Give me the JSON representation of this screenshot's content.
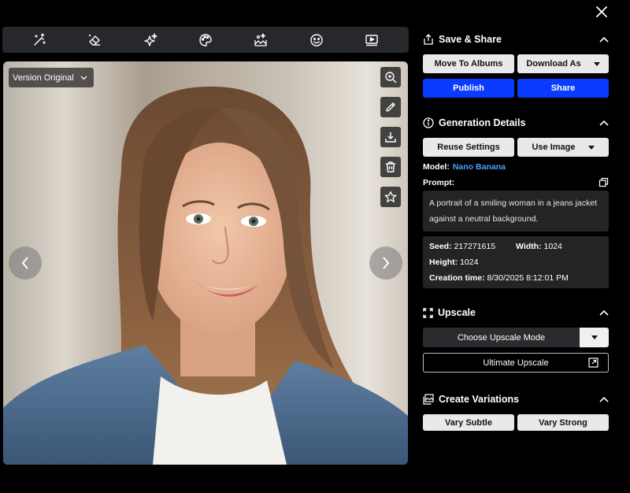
{
  "toolbar": {
    "tools": [
      "magic-wand-icon",
      "eraser-icon",
      "sparkles-icon",
      "palette-icon",
      "image-edit-icon",
      "smiley-icon",
      "video-icon"
    ]
  },
  "viewer": {
    "version_label": "Version Original",
    "side_actions": [
      "zoom-in-icon",
      "pencil-icon",
      "download-icon",
      "trash-icon",
      "star-icon"
    ]
  },
  "save_share": {
    "title": "Save & Share",
    "move_to_albums": "Move To Albums",
    "download_as": "Download As",
    "publish": "Publish",
    "share": "Share"
  },
  "generation": {
    "title": "Generation Details",
    "reuse_settings": "Reuse Settings",
    "use_image": "Use Image",
    "model_label": "Model:",
    "model_name": "Nano Banana",
    "prompt_label": "Prompt:",
    "prompt_text": "A portrait of a smiling woman in a jeans jacket against a neutral background.",
    "seed_label": "Seed:",
    "seed_value": "217271615",
    "width_label": "Width:",
    "width_value": "1024",
    "height_label": "Height:",
    "height_value": "1024",
    "creation_label": "Creation time:",
    "creation_value": "8/30/2025 8:12:01 PM"
  },
  "upscale": {
    "title": "Upscale",
    "mode_label": "Choose Upscale Mode",
    "ultimate_label": "Ultimate Upscale"
  },
  "variations": {
    "title": "Create Variations",
    "vary_subtle": "Vary Subtle",
    "vary_strong": "Vary Strong"
  },
  "colors": {
    "accent_blue": "#0a3cff",
    "model_link": "#4aa3ff",
    "panel_bg": "#232426"
  }
}
